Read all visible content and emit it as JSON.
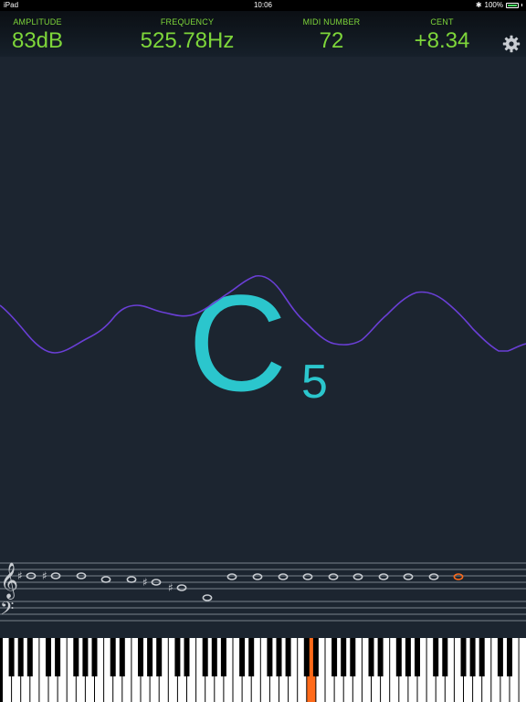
{
  "status_bar": {
    "device": "iPad",
    "time": "10:06",
    "battery": "100%"
  },
  "readout": {
    "amplitude": {
      "label": "AMPLITUDE",
      "value": "83dB"
    },
    "frequency": {
      "label": "FREQUENCY",
      "value": "525.78Hz"
    },
    "midi": {
      "label": "MIDI NUMBER",
      "value": "72"
    },
    "cent": {
      "label": "CENT",
      "value": "+8.34"
    }
  },
  "settings_icon": "gear-icon",
  "note": {
    "letter": "C",
    "octave": "5"
  },
  "colors": {
    "background": "#1c2530",
    "readout_green": "#7ed63a",
    "note_cyan": "#2bc6cd",
    "waveform_purple": "#6a3fd6",
    "highlight_orange": "#ff6a1a",
    "staff_lines": "#9aa2aa"
  },
  "staff": {
    "treble_clef": "𝄞",
    "bass_clef": "𝄢",
    "sharp": "♯",
    "note_glyph": "o"
  },
  "keyboard": {
    "highlighted_key": "C5"
  }
}
